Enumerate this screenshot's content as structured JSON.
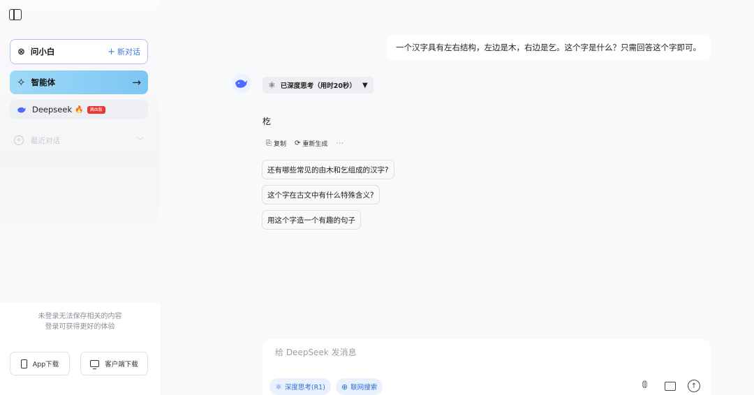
{
  "sidebar": {
    "wenxiaobai": {
      "label": "问小白",
      "new_chat": "新对话"
    },
    "agent": {
      "label": "智能体"
    },
    "deepseek": {
      "label": "Deepseek",
      "badge": "满血版"
    },
    "recent": {
      "label": "最近对话"
    },
    "login_note": {
      "line1": "未登录无法保存相关的内容",
      "line2": "登录可获得更好的体验"
    },
    "download": {
      "app": "App下载",
      "client": "客户端下载"
    }
  },
  "chat": {
    "user_message": "一个汉字具有左右结构，左边是木，右边是乞。这个字是什么？只需回答这个字即可。",
    "thinking": "已深度思考（用时20秒）",
    "answer": "杚",
    "actions": {
      "copy": "复制",
      "regenerate": "重新生成",
      "more": "···"
    },
    "suggestions": [
      "还有哪些常见的由木和乞组成的汉字?",
      "这个字在古文中有什么特殊含义?",
      "用这个字造一个有趣的句子"
    ]
  },
  "composer": {
    "placeholder": "给 DeepSeek 发消息",
    "chips": {
      "think": "深度思考(R1)",
      "web": "联网搜索"
    }
  },
  "icons": {
    "toggle": "sidebar-toggle-icon",
    "link": "link-icon",
    "agent": "sparkle-icon",
    "whale": "deepseek-whale-icon",
    "fire": "fire-icon",
    "attach": "paperclip-icon",
    "image": "image-icon",
    "send": "arrow-up-icon"
  },
  "colors": {
    "accent": "#3b7bdc",
    "agent_bg": "#8fd0f6",
    "badge": "#e53935"
  }
}
